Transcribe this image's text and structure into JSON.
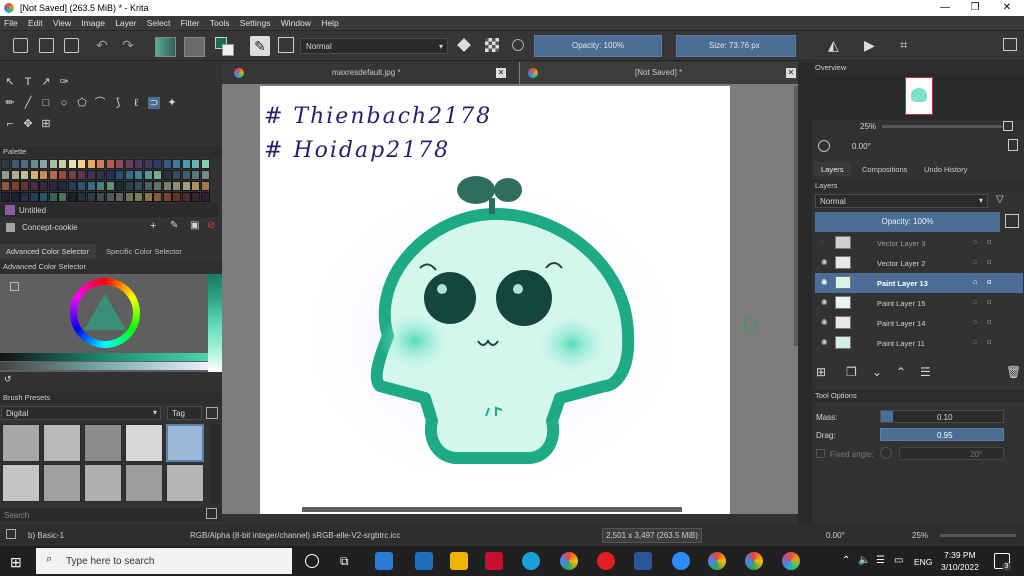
{
  "window": {
    "title": "[Not Saved]  (263.5 MiB)  * - Krita",
    "min_label": "—",
    "max_label": "❐",
    "close_label": "✕"
  },
  "menu": [
    "File",
    "Edit",
    "View",
    "Image",
    "Layer",
    "Select",
    "Filter",
    "Tools",
    "Settings",
    "Window",
    "Help"
  ],
  "toolbar": {
    "blend_mode": "Normal",
    "opacity_label": "Opacity: 100%",
    "size_label": "Size: 73.76 px"
  },
  "left": {
    "palette_title": "Palette",
    "palette_name": "Untitled",
    "palette_item": "Concept-cookie",
    "tab_advanced": "Advanced Color Selector",
    "tab_specific": "Specific Color Selector",
    "adv_title": "Advanced Color Selector",
    "brush_title": "Brush Presets",
    "brush_filter": "Digital",
    "tag_label": "Tag",
    "search_placeholder": "Search"
  },
  "tabs": {
    "doc1": "maxresdefault.jpg *",
    "doc2": "[Not Saved]  *"
  },
  "canvas": {
    "line1": "# Thienbach2178",
    "line2": "# Hoidap2178"
  },
  "right": {
    "overview_title": "Overview",
    "zoom": "25%",
    "rotation": "0.00°",
    "tab_layers": "Layers",
    "tab_compositions": "Compositions",
    "tab_undo": "Undo History",
    "layers_title": "Layers",
    "blend": "Normal",
    "opacity": "Opacity:  100%",
    "layers": [
      {
        "name": "Vector Layer 3",
        "dim": true
      },
      {
        "name": "Vector Layer 2",
        "dim": false
      },
      {
        "name": "Paint Layer 13",
        "selected": true
      },
      {
        "name": "Paint Layer 15"
      },
      {
        "name": "Paint Layer 14"
      },
      {
        "name": "Paint Layer 11"
      }
    ],
    "tool_options_title": "Tool Options",
    "mass_label": "Mass:",
    "mass_value": "0.10",
    "drag_label": "Drag:",
    "drag_value": "0.95",
    "fixed_angle_label": "Fixed angle:",
    "fixed_angle_value": "20°"
  },
  "status": {
    "brush": "b) Basic-1",
    "colorspace": "RGB/Alpha (8-bit integer/channel)  sRGB-elle-V2-srgbtrc.icc",
    "dims": "2,501 x 3,497 (263.5 MiB)",
    "rotation": "0.00°",
    "zoom": "25%"
  },
  "taskbar": {
    "search_placeholder": "Type here to search",
    "lang": "ENG",
    "time": "7:39 PM",
    "date": "3/10/2022",
    "notif": "3"
  },
  "colors": {
    "accent": "#4a6e95",
    "mint": "#1faa86",
    "ink": "#2a1d6e"
  }
}
